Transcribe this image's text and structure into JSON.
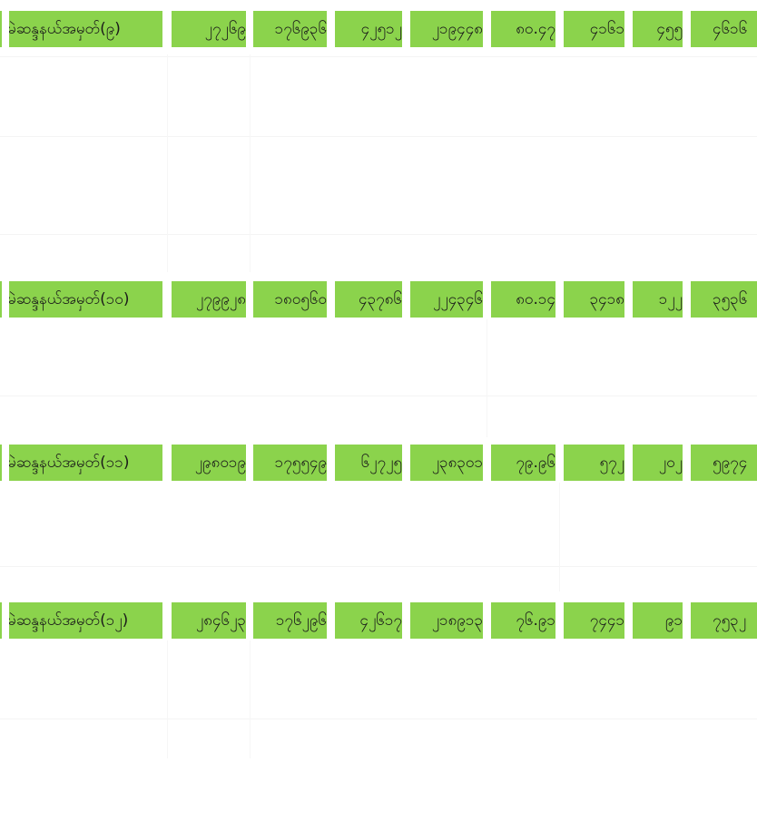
{
  "rows": [
    {
      "label": "မဲဆန္ဒနယ်အမှတ်(၉)",
      "values": [
        "၂၇၂၆၉",
        "၁၇၆၉၃၆",
        "၄၂၅၁၂",
        "၂၁၉၄၄၈",
        "၈၀.၄၇",
        "၄၁၆၁",
        "၄၅၅",
        "၄၆၁၆"
      ]
    },
    {
      "label": "မဲဆန္ဒနယ်အမှတ်(၁၀)",
      "values": [
        "၂၇၉၉၂၈",
        "၁၈၀၅၆၀",
        "၄၃၇၈၆",
        "၂၂၄၃၄၆",
        "၈၀.၁၄",
        "၃၄၁၈",
        "၁၂၂",
        "၃၅၃၆"
      ]
    },
    {
      "label": "မဲဆန္ဒနယ်အမှတ်(၁၁)",
      "values": [
        "၂၉၈၀၁၉",
        "၁၇၅၅၄၉",
        "၆၂၇၂၅",
        "၂၃၈၃၀၁",
        "၇၉.၉၆",
        "၅၇၂",
        "၂၀၂",
        "၅၉၇၄"
      ]
    },
    {
      "label": "မဲဆန္ဒနယ်အမှတ်(၁၂)",
      "values": [
        "၂၈၄၆၂၃",
        "၁၇၆၂၉၆",
        "၄၂၆၁၇",
        "၂၁၈၉၁၃",
        "၇၆.၉၁",
        "၇၄၄၁",
        "၉၁",
        "၇၅၃၂"
      ]
    }
  ],
  "colors": {
    "cell_background": "#8bd34c",
    "text": "#1a1a1a",
    "page_background": "#ffffff"
  }
}
